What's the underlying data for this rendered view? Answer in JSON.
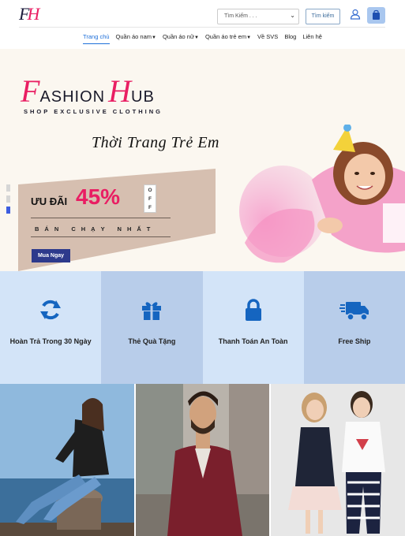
{
  "header": {
    "logo": {
      "f": "F",
      "h": "H"
    },
    "search_placeholder": "Tìm Kiếm . . .",
    "search_button": "Tìm kiếm",
    "icons": {
      "user": "user-icon",
      "cart": "shopping-bag-icon"
    },
    "accent": "#1e6fd9"
  },
  "nav": [
    {
      "label": "Trang chủ",
      "active": true
    },
    {
      "label": "Quần áo nam",
      "dropdown": true
    },
    {
      "label": "Quần áo nữ",
      "dropdown": true
    },
    {
      "label": "Quần áo trẻ em",
      "dropdown": true
    },
    {
      "label": "Về SVS"
    },
    {
      "label": "Blog"
    },
    {
      "label": "Liên hệ"
    }
  ],
  "hero": {
    "brand_initial_1": "F",
    "brand_rest_1": "ASHION",
    "brand_initial_2": "H",
    "brand_rest_2": "UB",
    "brand_sub": "SHOP EXCLUSIVE CLOTHING",
    "title": "Thời Trang Trẻ Em",
    "promo_label": "ƯU ĐÃI",
    "promo_percent": "45%",
    "off_letters": [
      "O",
      "F",
      "F"
    ],
    "best_seller": "BÁN CHẠY NHẤT",
    "buy_button": "Mua Ngay",
    "slides": 3,
    "active_slide": 3,
    "brand_color": "#e91e63"
  },
  "features": [
    {
      "icon": "refresh-icon",
      "text": "Hoàn Trả Trong 30 Ngày"
    },
    {
      "icon": "gift-icon",
      "text": "Thẻ Quà Tặng"
    },
    {
      "icon": "lock-icon",
      "text": "Thanh Toán An Toàn"
    },
    {
      "icon": "shipping-truck-icon",
      "text": "Free Ship"
    }
  ],
  "gallery": [
    {
      "name": "woman-leather-jacket-photo"
    },
    {
      "name": "man-burgundy-jacket-photo"
    },
    {
      "name": "kids-fashion-photo"
    }
  ]
}
